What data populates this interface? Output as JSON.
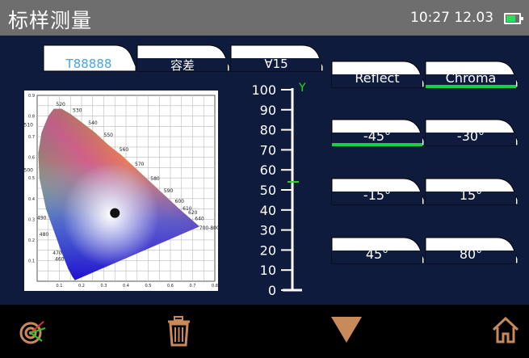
{
  "header": {
    "title": "标样测量",
    "time": "10:27 12.03",
    "battery_icon": "battery-icon"
  },
  "tabs": [
    {
      "label": "T88888",
      "active": true
    },
    {
      "label": "容差",
      "active": false
    },
    {
      "label": "∀15",
      "active": false
    }
  ],
  "right_buttons": [
    {
      "label": "Reflect",
      "selected": false
    },
    {
      "label": "Chroma",
      "selected": true
    },
    {
      "label": "-45°",
      "selected": true
    },
    {
      "label": "-30°",
      "selected": false
    },
    {
      "label": "-15°",
      "selected": false
    },
    {
      "label": "15°",
      "selected": false
    },
    {
      "label": "45°",
      "selected": false
    },
    {
      "label": "80°",
      "selected": false
    }
  ],
  "chart_data": {
    "type": "scatter",
    "y_ticks": [
      "0.1",
      "0.2",
      "0.3",
      "0.4",
      "0.5",
      "0.6",
      "0.7",
      "0.8",
      "0.9"
    ],
    "x_ticks": [
      "0.1",
      "0.2",
      "0.3",
      "0.4",
      "0.5",
      "0.6",
      "0.7",
      "0.8"
    ],
    "wavelength_labels": [
      "520",
      "530",
      "540",
      "550",
      "560",
      "570",
      "580",
      "590",
      "600",
      "610",
      "620",
      "640",
      "700-800",
      "510",
      "500",
      "490",
      "480",
      "470",
      "460"
    ],
    "point": {
      "x": 0.35,
      "y": 0.33
    },
    "xlim": [
      0,
      0.8
    ],
    "ylim": [
      0,
      0.9
    ]
  },
  "gauge": {
    "axis_label": "Y",
    "ticks": [
      "100",
      "90",
      "80",
      "70",
      "60",
      "50",
      "40",
      "30",
      "20",
      "10",
      "0"
    ],
    "marker_value": 54
  },
  "footer": {
    "icons": [
      "target-icon",
      "trash-icon",
      "triangle-down-icon",
      "home-icon"
    ],
    "accent": "#c98a5b"
  },
  "colors": {
    "background": "#0f1b3d",
    "title_bar": "#6e6e6e",
    "selected_underline": "#17d23e",
    "axis_y_label": "#1ee01e"
  }
}
